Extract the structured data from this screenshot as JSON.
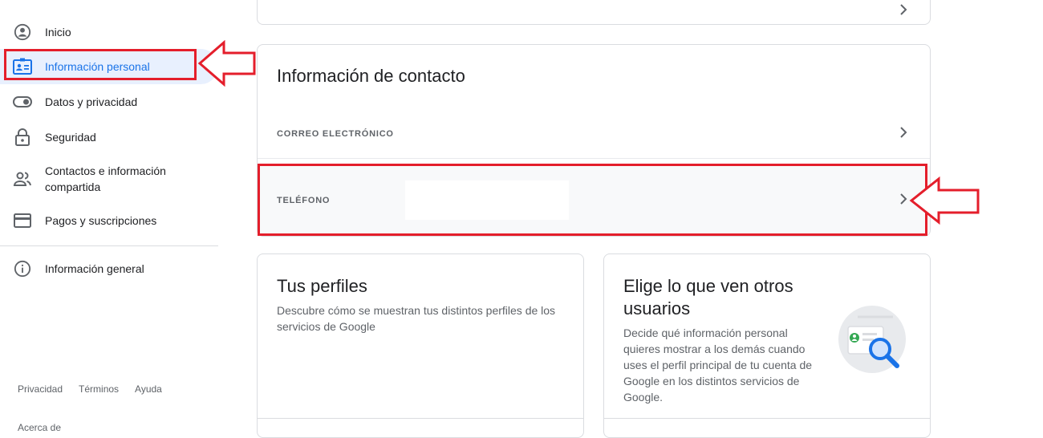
{
  "sidebar": {
    "items": [
      {
        "label": "Inicio",
        "icon": "account-circle-icon"
      },
      {
        "label": "Información personal",
        "icon": "id-card-icon"
      },
      {
        "label": "Datos y privacidad",
        "icon": "toggle-icon"
      },
      {
        "label": "Seguridad",
        "icon": "lock-icon"
      },
      {
        "label": "Contactos e información compartida",
        "icon": "people-icon"
      },
      {
        "label": "Pagos y suscripciones",
        "icon": "credit-card-icon"
      },
      {
        "label": "Información general",
        "icon": "info-icon"
      }
    ],
    "active_index": 1,
    "footer": {
      "privacy": "Privacidad",
      "terms": "Términos",
      "help": "Ayuda",
      "about": "Acerca de"
    }
  },
  "contact": {
    "title": "Información de contacto",
    "email_label": "CORREO ELECTRÓNICO",
    "phone_label": "TELÉFONO"
  },
  "profiles": {
    "title": "Tus perfiles",
    "description": "Descubre cómo se muestran tus distintos perfiles de los servicios de Google"
  },
  "choose": {
    "title": "Elige lo que ven otros usuarios",
    "description": "Decide qué información personal quieres mostrar a los demás cuando uses el perfil principal de tu cuenta de Google en los distintos servicios de Google."
  },
  "colors": {
    "accent": "#1a73e8",
    "annotation": "#e41e2b",
    "active_bg": "#e8f0fe"
  }
}
